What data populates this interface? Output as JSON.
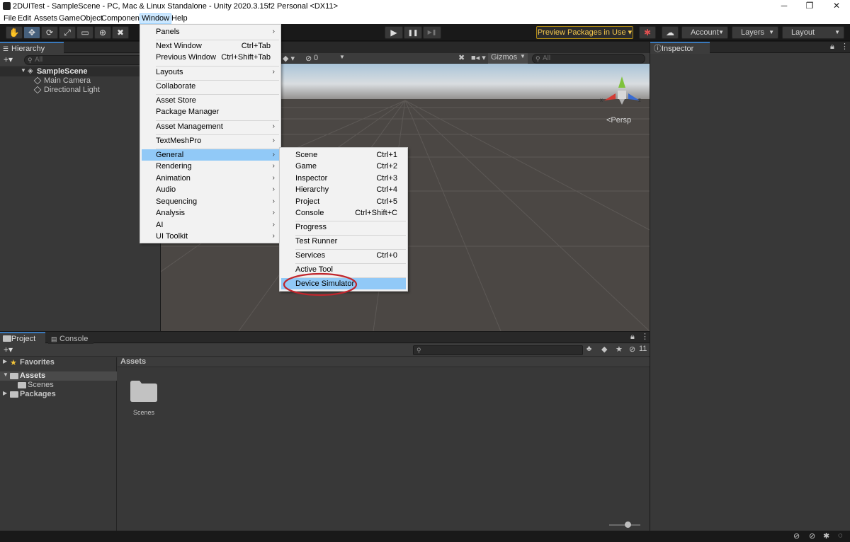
{
  "titlebar": {
    "title": "2DUITest - SampleScene - PC, Mac & Linux Standalone - Unity 2020.3.15f2 Personal <DX11>",
    "minimize": "─",
    "restore": "❐",
    "close": "✕"
  },
  "menubar": {
    "items": [
      "File",
      "Edit",
      "Assets",
      "GameObject",
      "Component",
      "Window",
      "Help"
    ]
  },
  "toolbar": {
    "tools": [
      "✋",
      "✥",
      "⟳",
      "⤢",
      "▭",
      "⊕",
      "✖"
    ],
    "play": "▶",
    "pause": "❚❚",
    "step": "▶❚",
    "preview_packages": "Preview Packages in Use ▾",
    "account": "Account",
    "layers": "Layers",
    "layout": "Layout"
  },
  "hierarchy": {
    "tab": "Hierarchy",
    "add": "+▾",
    "search_placeholder": "All",
    "scene": "SampleScene",
    "children": [
      "Main Camera",
      "Directional Light"
    ]
  },
  "scene_view": {
    "toolbar_count": "0",
    "gizmos": "Gizmos",
    "search_placeholder": "All",
    "persp": "<Persp",
    "axis_x": "x",
    "axis_z": "z"
  },
  "inspector": {
    "tab": "Inspector"
  },
  "project": {
    "tabs": [
      "Project",
      "Console"
    ],
    "add": "+▾",
    "hidden_count": "11",
    "tree": {
      "favorites": "Favorites",
      "assets": "Assets",
      "scenes": "Scenes",
      "packages": "Packages"
    },
    "breadcrumb": "Assets",
    "folder": "Scenes"
  },
  "window_menu": {
    "items": [
      {
        "label": "Panels",
        "submenu": true
      },
      {
        "label": "Next Window",
        "shortcut": "Ctrl+Tab"
      },
      {
        "label": "Previous Window",
        "shortcut": "Ctrl+Shift+Tab"
      },
      {
        "label": "Layouts",
        "submenu": true
      },
      {
        "label": "Collaborate"
      },
      {
        "label": "Asset Store"
      },
      {
        "label": "Package Manager"
      },
      {
        "label": "Asset Management",
        "submenu": true
      },
      {
        "label": "TextMeshPro",
        "submenu": true
      },
      {
        "label": "General",
        "submenu": true,
        "highlighted": true
      },
      {
        "label": "Rendering",
        "submenu": true
      },
      {
        "label": "Animation",
        "submenu": true
      },
      {
        "label": "Audio",
        "submenu": true
      },
      {
        "label": "Sequencing",
        "submenu": true
      },
      {
        "label": "Analysis",
        "submenu": true
      },
      {
        "label": "AI",
        "submenu": true
      },
      {
        "label": "UI Toolkit",
        "submenu": true
      }
    ]
  },
  "general_menu": {
    "items": [
      {
        "label": "Scene",
        "shortcut": "Ctrl+1"
      },
      {
        "label": "Game",
        "shortcut": "Ctrl+2"
      },
      {
        "label": "Inspector",
        "shortcut": "Ctrl+3"
      },
      {
        "label": "Hierarchy",
        "shortcut": "Ctrl+4"
      },
      {
        "label": "Project",
        "shortcut": "Ctrl+5"
      },
      {
        "label": "Console",
        "shortcut": "Ctrl+Shift+C"
      },
      {
        "label": "Progress"
      },
      {
        "label": "Test Runner"
      },
      {
        "label": "Services",
        "shortcut": "Ctrl+0"
      },
      {
        "label": "Active Tool"
      },
      {
        "label": "Device Simulator",
        "highlighted": true
      }
    ]
  },
  "colors": {
    "highlight": "#91c9f7",
    "annotation_circle": "#c0262d",
    "preview_packages": "#f6c84b"
  }
}
